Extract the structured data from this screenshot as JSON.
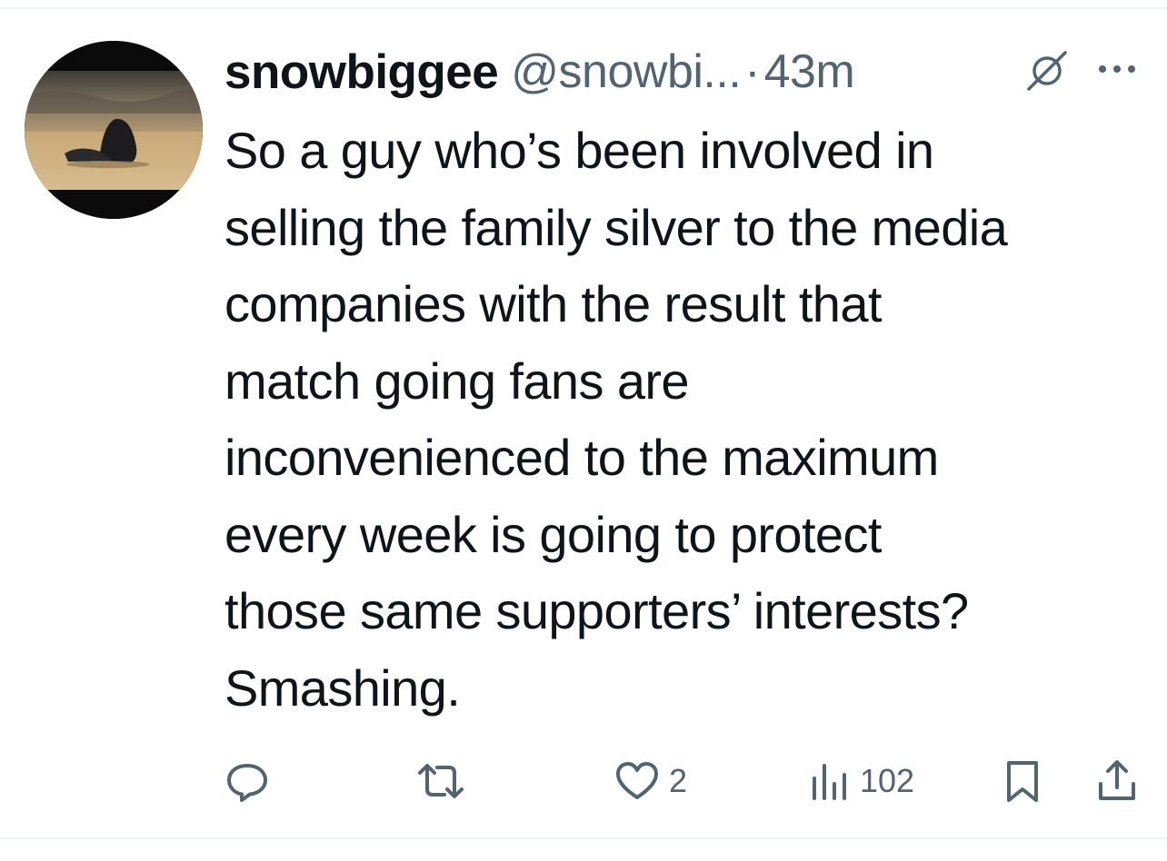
{
  "tweet": {
    "display_name": "snowbiggee",
    "handle": "@snowbi...",
    "separator": "·",
    "time": "43m",
    "lines": [
      "So a guy who’s been involved in",
      "selling the family silver to the media",
      "companies with the result that",
      "match going fans are",
      "inconvenienced to the maximum",
      "every week is going to protect",
      "those same supporters’ interests?",
      "Smashing."
    ]
  },
  "actions": {
    "reply_icon": "reply-icon",
    "retweet_icon": "retweet-icon",
    "like_icon": "heart-icon",
    "like_count": "2",
    "views_icon": "views-bar-chart-icon",
    "views_count": "102",
    "bookmark_icon": "bookmark-icon",
    "share_icon": "share-icon"
  },
  "colors": {
    "text_primary": "#0f1419",
    "text_secondary": "#536471",
    "divider": "#eff3f4"
  }
}
